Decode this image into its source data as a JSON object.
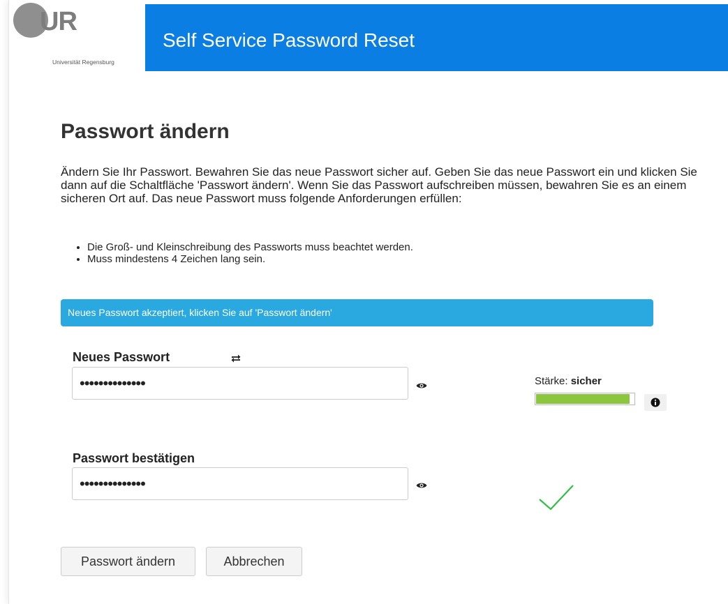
{
  "header": {
    "logo_letters": "UR",
    "logo_caption": "Universität Regensburg",
    "title": "Self Service Password Reset",
    "bar_color": "#0b7ee3"
  },
  "page": {
    "title": "Passwort ändern",
    "intro": "Ändern Sie Ihr Passwort. Bewahren Sie das neue Passwort sicher auf. Geben Sie das neue Passwort ein und klicken Sie dann auf die Schaltfläche 'Passwort ändern'. Wenn Sie das Passwort aufschreiben müssen, bewahren Sie es an einem sicheren Ort auf. Das neue Passwort muss folgende Anforderungen erfüllen:",
    "requirements": [
      "Die Groß- und Kleinschreibung des Passworts muss beachtet werden.",
      "Muss mindestens 4 Zeichen lang sein."
    ],
    "alert": "Neues Passwort akzeptiert, klicken Sie auf 'Passwort ändern'",
    "alert_color": "#29a9df"
  },
  "form": {
    "new_password_label": "Neues Passwort",
    "new_password_value": "••••••••••••••",
    "confirm_label": "Passwort bestätigen",
    "confirm_value": "••••••••••••••",
    "strength_prefix": "Stärke:",
    "strength_value": "sicher",
    "strength_level": 0.96,
    "strength_color": "#8cc63f",
    "match_icon": "check-icon",
    "match_color": "#2fbf44"
  },
  "buttons": {
    "submit": "Passwort ändern",
    "cancel": "Abbrechen"
  },
  "icons": {
    "regenerate": "refresh-icon",
    "reveal": "eye-icon",
    "info": "info-icon"
  }
}
